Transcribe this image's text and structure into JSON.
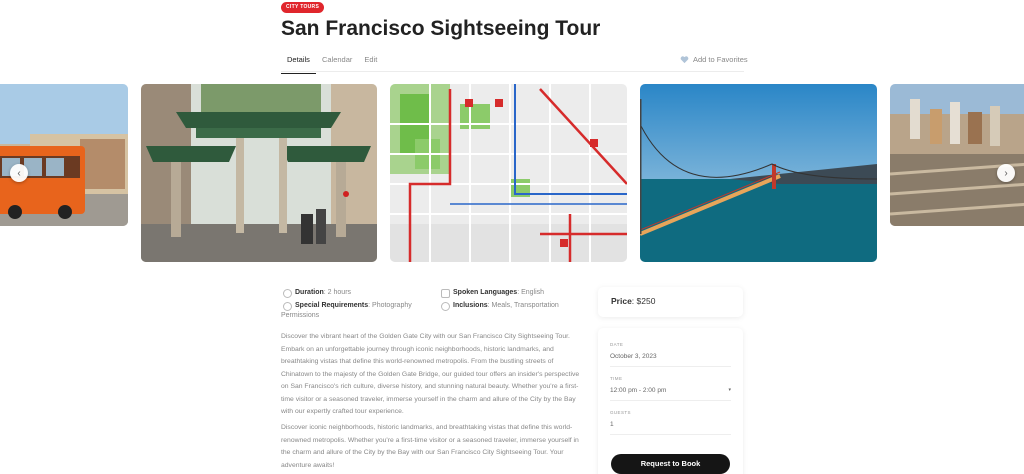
{
  "header": {
    "badge": "CITY TOURS",
    "title": "San Francisco Sightseeing Tour"
  },
  "tabs": [
    {
      "label": "Details",
      "active": true
    },
    {
      "label": "Calendar",
      "active": false
    },
    {
      "label": "Edit",
      "active": false
    }
  ],
  "favorites_label": "Add to Favorites",
  "gallery": {
    "images": [
      "cable-bus",
      "chinatown-gate",
      "route-map",
      "golden-gate-bridge",
      "city-skyline"
    ],
    "prev_icon": "chevron-left-icon",
    "next_icon": "chevron-right-icon"
  },
  "info": {
    "duration_label": "Duration",
    "duration_value": ": 2 hours",
    "languages_label": "Spoken Languages",
    "languages_value": ": English",
    "requirements_label": "Special Requirements",
    "requirements_value": ": Photography",
    "requirements_value_2": "Permissions",
    "inclusions_label": "Inclusions",
    "inclusions_value": ": Meals, Transportation"
  },
  "description": {
    "p1": "Discover the vibrant heart of the Golden Gate City with our San Francisco City Sightseeing Tour. Embark on an unforgettable journey through iconic neighborhoods, historic landmarks, and breathtaking vistas that define this world-renowned metropolis. From the bustling streets of Chinatown to the majesty of the Golden Gate Bridge, our guided tour offers an insider's perspective on San Francisco's rich culture, diverse history, and stunning natural beauty. Whether you're a first-time visitor or a seasoned traveler, immerse yourself in the charm and allure of the City by the Bay with our expertly crafted tour experience.",
    "p2": "Discover iconic neighborhoods, historic landmarks, and breathtaking vistas that define this world-renowned metropolis. Whether you're a first-time visitor or a seasoned traveler, immerse yourself in the charm and allure of the City by the Bay with our San Francisco City Sightseeing Tour. Your adventure awaits!"
  },
  "booking": {
    "price_label": "Price",
    "price_value": ": $250",
    "date_label": "DATE",
    "date_value": "October 3, 2023",
    "time_label": "TIME",
    "time_value": "12:00 pm - 2:00 pm",
    "guests_label": "GUESTS",
    "guests_value": "1",
    "button": "Request to Book"
  },
  "colors": {
    "badge": "#e0262c",
    "button": "#151515",
    "heart": "#b0c4d8"
  }
}
